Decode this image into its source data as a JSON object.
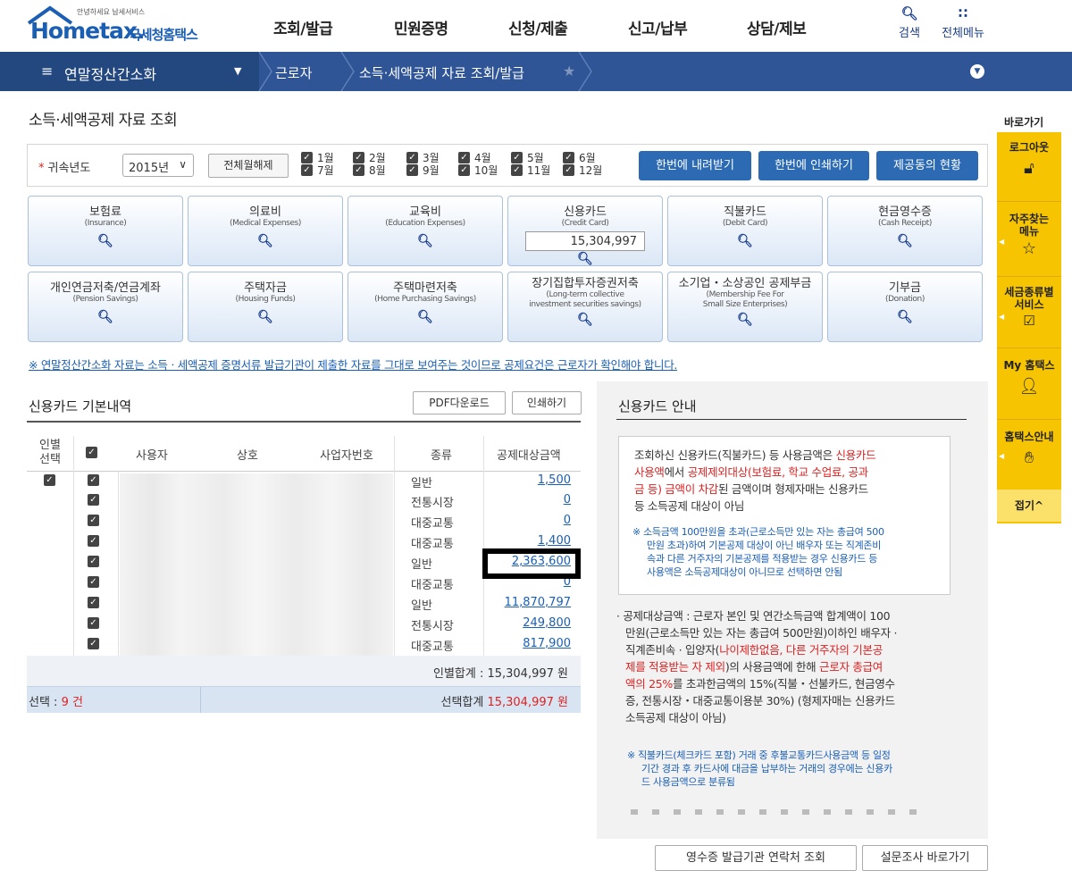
{
  "header": {
    "logo_small": "안녕하세요 납세서비스",
    "logo_brand": "Hometax.",
    "logo_kr": "국세청홈택스",
    "nav": [
      "조회/발급",
      "민원증명",
      "신청/제출",
      "신고/납부",
      "상담/제보"
    ],
    "search_label": "검색",
    "allmenu_label": "전체메뉴"
  },
  "navbar": {
    "menu": "연말정산간소화",
    "crumb1": "근로자",
    "crumb2": "소득·세액공제 자료 조회/발급"
  },
  "page_title": "소득·세액공제 자료 조회",
  "filter": {
    "year_label": "귀속년도",
    "year_value": "2015년",
    "deselect_all": "전체월해제",
    "months_row1": [
      "1월",
      "2월",
      "3월",
      "4월",
      "5월",
      "6월"
    ],
    "months_row2": [
      "7월",
      "8월",
      "9월",
      "10월",
      "11월",
      "12월"
    ],
    "btn_download_all": "한번에 내려받기",
    "btn_print_all": "한번에 인쇄하기",
    "btn_consent": "제공동의 현황"
  },
  "tiles": [
    {
      "ko": "보험료",
      "en": "(Insurance)"
    },
    {
      "ko": "의료비",
      "en": "(Medical Expenses)"
    },
    {
      "ko": "교육비",
      "en": "(Education Expenses)"
    },
    {
      "ko": "신용카드",
      "en": "(Credit Card)",
      "value": "15,304,997"
    },
    {
      "ko": "직불카드",
      "en": "(Debit Card)"
    },
    {
      "ko": "현금영수증",
      "en": "(Cash Receipt)"
    },
    {
      "ko": "개인연금저축/연금계좌",
      "en": "(Pension Savings)"
    },
    {
      "ko": "주택자금",
      "en": "(Housing Funds)"
    },
    {
      "ko": "주택마련저축",
      "en": "(Home Purchasing Savings)"
    },
    {
      "ko": "장기집합투자증권저축",
      "en": "(Long-term collective",
      "en2": "investment securities savings)"
    },
    {
      "ko": "소기업・소상공인 공제부금",
      "en": "(Membership Fee For",
      "en2": "Small Size Enterprises)"
    },
    {
      "ko": "기부금",
      "en": "(Donation)"
    }
  ],
  "notice": "※ 연말정산간소화 자료는 소득ㆍ세액공제 증명서류 발급기관이 제출한 자료를 그대로 보여주는 것이므로 공제요건은 근로자가 확인해야 합니다.",
  "card_section": {
    "title": "신용카드 기본내역",
    "btn_pdf": "PDF다운로드",
    "btn_print": "인쇄하기",
    "headers": {
      "select1": "인별",
      "select2": "선택",
      "user": "사용자",
      "store": "상호",
      "bizno": "사업자번호",
      "kind": "종류",
      "amount": "공제대상금액"
    },
    "rows": [
      {
        "kind": "일반",
        "amount": "1,500"
      },
      {
        "kind": "전통시장",
        "amount": "0"
      },
      {
        "kind": "대중교통",
        "amount": "0"
      },
      {
        "kind": "대중교통",
        "amount": "1,400"
      },
      {
        "kind": "일반",
        "amount": "2,363,600"
      },
      {
        "kind": "대중교통",
        "amount": "0"
      },
      {
        "kind": "일반",
        "amount": "11,870,797"
      },
      {
        "kind": "전통시장",
        "amount": "249,800"
      },
      {
        "kind": "대중교통",
        "amount": "817,900"
      }
    ],
    "person_total": "인별합계 : 15,304,997 원",
    "selected_label": "선택 :",
    "selected_count": "9 건",
    "selected_total_label": "선택합계",
    "selected_total_value": "15,304,997 원"
  },
  "guide": {
    "title": "신용카드 안내",
    "box_p1": "조회하신 신용카드(직불카드) 등 사용금액은",
    "box_p1_red1": "신용카드",
    "box_p2_red": "사용액",
    "box_p2": "에서",
    "box_p2_red2": "공제제외대상(보험료, 학교 수업료, 공과",
    "box_p3_red": "금 등) 금액이 차감",
    "box_p3": "된 금액이며 형제자매는 신용카드",
    "box_p4": "등 소득공제 대상이 아님",
    "box_note": [
      "※ 소득금액 100만원을 초과(근로소득만 있는 자는 총급여 500",
      "만원 초과)하여 기본공제 대상이 아닌 배우자 또는 직계존비",
      "속과 다른 거주자의 기본공제를 적용받는 경우 신용카드 등",
      "사용액은 소득공제대상이 아니므로 선택하면 안됨"
    ],
    "p1": "· 공제대상금액 : 근로자 본인 및 연간소득금액 합계액이 100",
    "p2": "만원(근로소득만 있는 자는 총급여 500만원)이하인 배우자 ·",
    "p3a": "직계존비속 · 입양자(",
    "p3_red": "나이제한없음, 다른 거주자의 기본공",
    "p4_red": "제를 적용받는 자 제외",
    "p4": ")의 사용금액에 한해",
    "p4_red2": "근로자 총급여",
    "p5_red": "액의 25%",
    "p5": "를 초과한금액의 15%(직불・선불카드, 현금영수",
    "p6": "증, 전통시장・대중교통이용분 30%) (형제자매는 신용카드",
    "p7": "소득공제 대상이 아님)",
    "note2": [
      "※ 직불카드(체크카드 포함) 거래 중 후불교통카드사용금액 등 일정",
      "기간 경과 후 카드사에 대금을 납부하는 거래의 경우에는 신용카",
      "드 사용금액으로 분류됨"
    ]
  },
  "bottom": {
    "btn_receipt": "영수증 발급기관 연락처 조회",
    "btn_survey": "설문조사 바로가기"
  },
  "quickbar": {
    "title": "바로가기",
    "items": [
      "로그아웃",
      "자주찾는",
      "메뉴",
      "세금종류별",
      "서비스",
      "My 홈택스",
      "홈택스안내"
    ],
    "fold": "접기^"
  },
  "colors": {
    "nav": "#2f5596",
    "accent": "#2c6bb3",
    "quick": "#f6c400",
    "red": "#d22222"
  }
}
